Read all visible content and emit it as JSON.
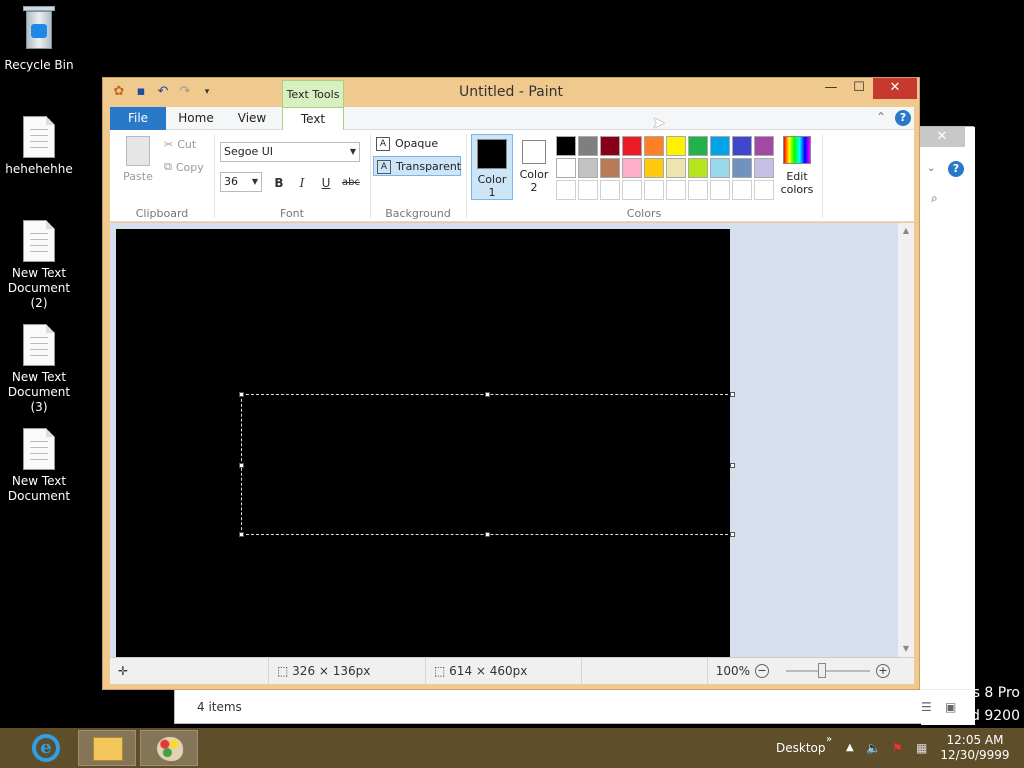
{
  "desktop": {
    "icons": [
      {
        "label": "Recycle Bin"
      },
      {
        "label": "hehehehhe"
      },
      {
        "label": "New Text Document (2)"
      },
      {
        "label": "New Text Document (3)"
      },
      {
        "label": "New Text Document"
      }
    ],
    "watermark_line1": "s 8 Pro",
    "watermark_line2": "d 9200"
  },
  "explorer": {
    "status_items": "4 items"
  },
  "paint": {
    "title": "Untitled - Paint",
    "context_tab": "Text Tools",
    "tabs": {
      "file": "File",
      "home": "Home",
      "view": "View",
      "text": "Text"
    },
    "clipboard": {
      "paste": "Paste",
      "cut": "Cut",
      "copy": "Copy",
      "label": "Clipboard"
    },
    "font": {
      "family": "Segoe UI",
      "size": "36",
      "bold": "B",
      "italic": "I",
      "underline": "U",
      "strike": "abc",
      "label": "Font"
    },
    "background": {
      "opaque": "Opaque",
      "transparent": "Transparent",
      "label": "Background"
    },
    "colors": {
      "color1": "Color 1",
      "color2": "Color 2",
      "color1_value": "#000000",
      "color2_value": "#ffffff",
      "edit": "Edit colors",
      "label": "Colors",
      "palette": [
        "#000000",
        "#7f7f7f",
        "#880015",
        "#ed1c24",
        "#ff7f27",
        "#fff200",
        "#22b14c",
        "#00a2e8",
        "#3f48cc",
        "#a349a4",
        "#ffffff",
        "#c3c3c3",
        "#b97a57",
        "#ffaec9",
        "#ffc90e",
        "#efe4b0",
        "#b5e61d",
        "#99d9ea",
        "#7092be",
        "#c8bfe7",
        "#ffffff",
        "#ffffff",
        "#ffffff",
        "#ffffff",
        "#ffffff",
        "#ffffff",
        "#ffffff",
        "#ffffff",
        "#ffffff",
        "#ffffff"
      ]
    },
    "status": {
      "selection": "326 × 136px",
      "image_size": "614 × 460px",
      "zoom": "100%"
    }
  },
  "taskbar": {
    "desktop_label": "Desktop",
    "time": "12:05 AM",
    "date": "12/30/9999"
  }
}
